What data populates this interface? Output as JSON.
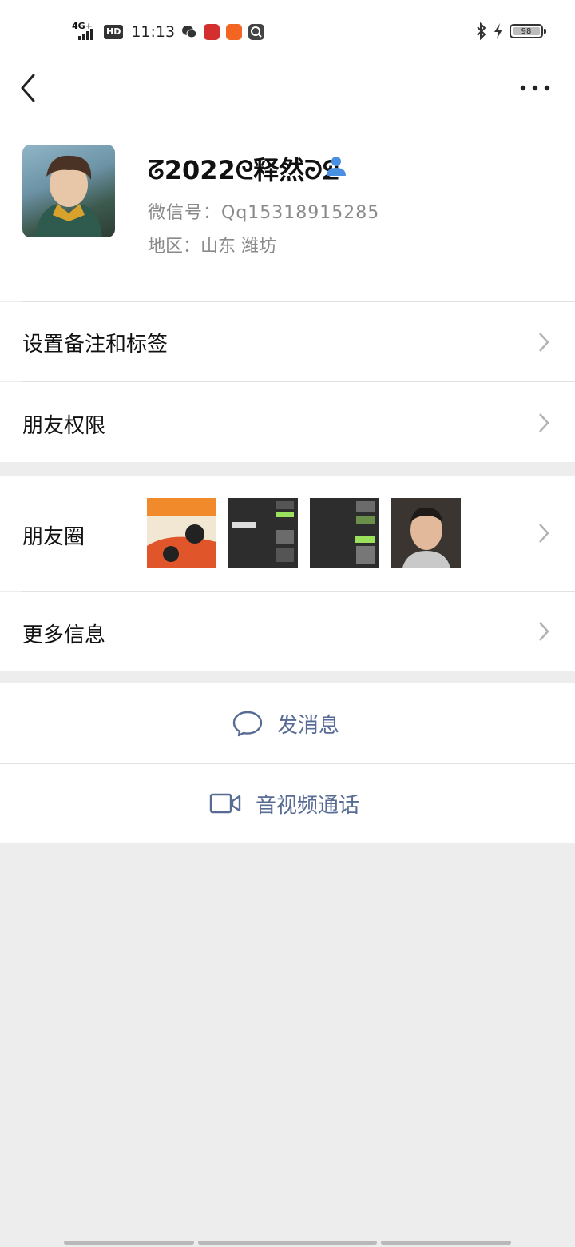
{
  "status_bar": {
    "network": "4G+",
    "hd_badge": "HD",
    "time": "11:13",
    "battery_level": "98"
  },
  "nav": {
    "back_icon": "chevron-left-icon",
    "more_icon": "more-dots-icon"
  },
  "profile": {
    "nickname": "ᘔ2022ᘓ释然ᘒᘖ",
    "wechat_id_label": "微信号：",
    "wechat_id_value": "Qq15318915285",
    "region_label": "地区：",
    "region_value": "山东 潍坊"
  },
  "menu": {
    "remark_tags": "设置备注和标签",
    "friend_permissions": "朋友权限",
    "moments": "朋友圈",
    "more_info": "更多信息"
  },
  "moments_thumbs": [
    "poster",
    "chat-screenshot-1",
    "chat-screenshot-2",
    "selfie"
  ],
  "actions": {
    "send_message": "发消息",
    "av_call": "音视频通话"
  },
  "colors": {
    "link_blue": "#576b95",
    "background": "#ededed",
    "divider": "#e2e2e2"
  }
}
